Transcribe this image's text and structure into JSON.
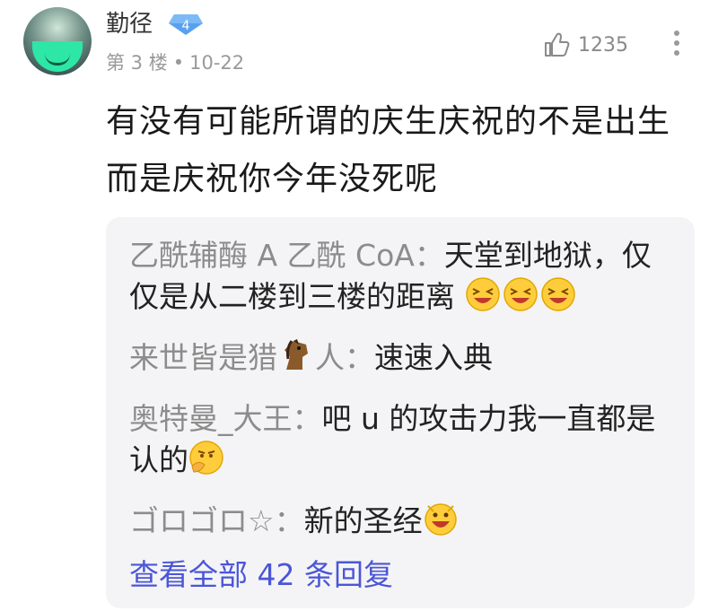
{
  "comment": {
    "username": "勤径",
    "level": "4",
    "floor": "第 3 楼",
    "separator": "•",
    "date": "10-22",
    "likes": "1235",
    "text": "有没有可能所谓的庆生庆祝的不是出生而是庆祝你今年没死呢"
  },
  "replies": [
    {
      "name": "乙酰辅酶 A 乙酰 CoA：",
      "text": "天堂到地狱，仅仅是从二楼到三楼的距离",
      "emoji": [
        "laughing-emoji",
        "laughing-emoji",
        "laughing-emoji"
      ]
    },
    {
      "name_part1": "来世皆是猎",
      "name_part2": "人：",
      "name_emoji": "horse-emoji",
      "text": "速速入典"
    },
    {
      "name": "奥特曼_大王：",
      "text": "吧 u 的攻击力我一直都是认的",
      "emoji": [
        "thinking-emoji"
      ]
    },
    {
      "name": "ゴロゴロ☆：",
      "text": "新的圣经",
      "emoji": [
        "grinning-emoji"
      ]
    }
  ],
  "view_all": "查看全部 42 条回复",
  "colors": {
    "link": "#4b56d6",
    "muted": "#9a9a9a",
    "panel": "#f4f4f6",
    "badge": "#5aa0f0"
  }
}
